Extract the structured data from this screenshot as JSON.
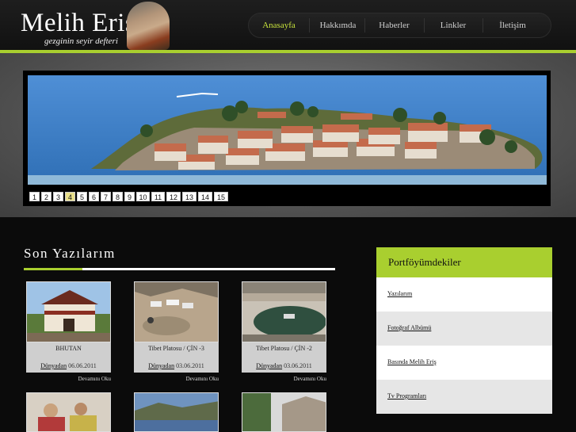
{
  "header": {
    "title": "Melih Eriş",
    "subtitle": "gezginin seyir defteri"
  },
  "nav": {
    "items": [
      {
        "label": "Anasayfa",
        "active": true
      },
      {
        "label": "Hakkımda",
        "active": false
      },
      {
        "label": "Haberler",
        "active": false
      },
      {
        "label": "Linkler",
        "active": false
      },
      {
        "label": "İletişim",
        "active": false
      }
    ]
  },
  "slideshow": {
    "pages": [
      "1",
      "2",
      "3",
      "4",
      "5",
      "6",
      "7",
      "8",
      "9",
      "10",
      "11",
      "12",
      "13",
      "14",
      "15"
    ],
    "active_page": "4"
  },
  "posts": {
    "title": "Son Yazılarım",
    "items": [
      {
        "title": "BHUTAN",
        "category": "Dünyadan",
        "date": "06.06.2011",
        "more": "Devamını Oku"
      },
      {
        "title": "Tibet Platosu / ÇİN -3",
        "category": "Dünyadan",
        "date": "03.06.2011",
        "more": "Devamını Oku"
      },
      {
        "title": "Tibet Platosu / ÇİN -2",
        "category": "Dünyadan",
        "date": "03.06.2011",
        "more": "Devamını Oku"
      }
    ]
  },
  "sidebar": {
    "title": "Portföyümdekiler",
    "items": [
      "Yazılarım",
      "Fotoğraf Albümü",
      "Basında Melih Eriş",
      "Tv Programları"
    ]
  },
  "colors": {
    "accent": "#a9cf2f",
    "background": "#0b0b0b"
  }
}
